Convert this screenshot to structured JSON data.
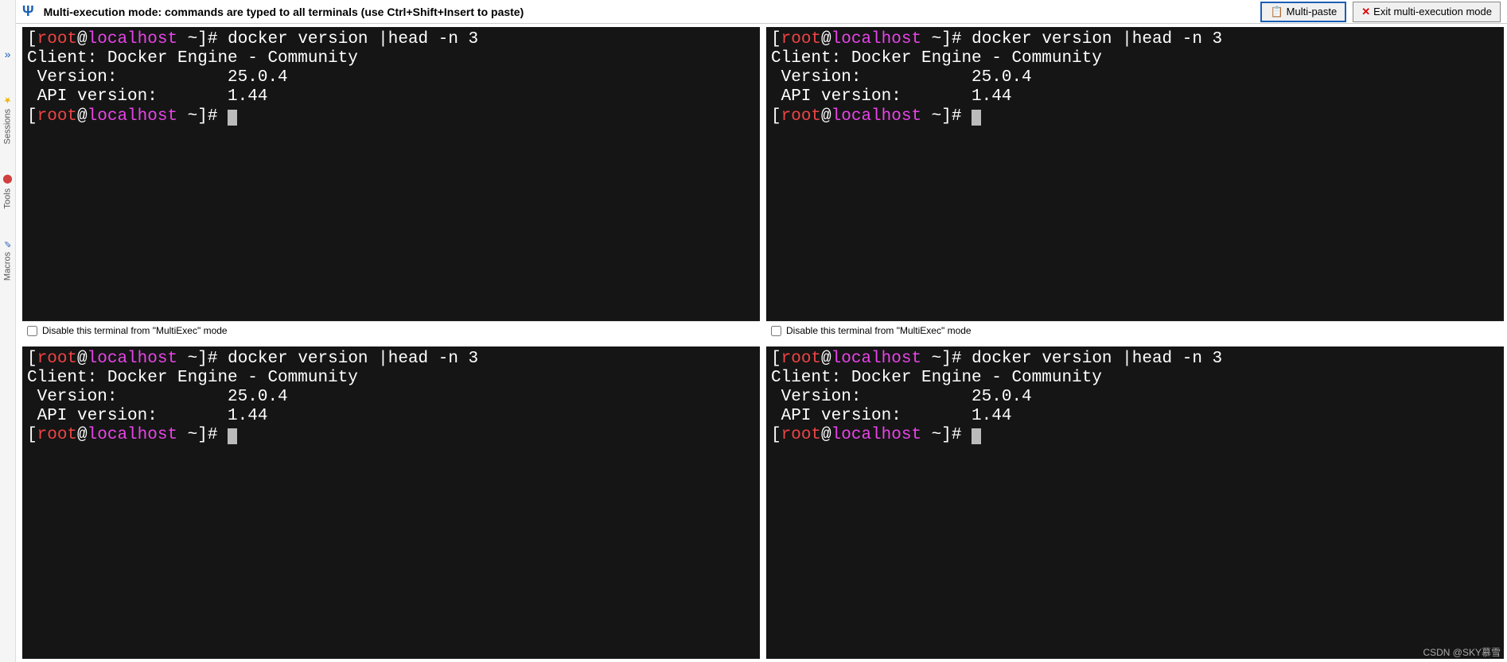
{
  "sidebar": {
    "items": [
      {
        "label": "Sessions",
        "icon": "★"
      },
      {
        "label": "Tools",
        "icon": "⬤"
      },
      {
        "label": "Macros",
        "icon": "✎"
      }
    ]
  },
  "topbar": {
    "title": "Multi-execution mode: commands are typed to all terminals (use Ctrl+Shift+Insert to paste)",
    "multi_paste_label": "Multi-paste",
    "exit_label": "Exit multi-execution mode"
  },
  "terminal": {
    "disable_checkbox_label": "Disable this terminal from \"MultiExec\" mode",
    "prompt": {
      "bracket_open": "[",
      "user": "root",
      "at": "@",
      "host": "localhost",
      "path": " ~",
      "bracket_close": "]",
      "symbol": "# "
    },
    "command": "docker version |head -n 3",
    "output_line1": "Client: Docker Engine - Community",
    "output_line2": " Version:           25.0.4",
    "output_line3": " API version:       1.44"
  },
  "watermark": "CSDN @SKY慕雪"
}
